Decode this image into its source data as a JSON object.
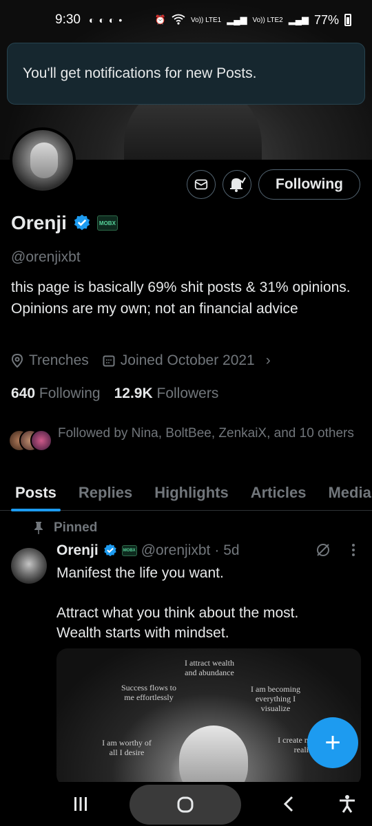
{
  "status_bar": {
    "time": "9:30",
    "battery": "77%",
    "sim1": "Vo)) LTE1",
    "sim2": "Vo)) LTE2"
  },
  "toast": {
    "message": "You'll get notifications for new Posts."
  },
  "profile": {
    "name": "Orenji",
    "org_badge": "MOBX",
    "handle": "@orenjixbt",
    "bio": "this page is basically 69% shit posts & 31% opinions. Opinions are my own; not an financial advice",
    "location": "Trenches",
    "joined": "Joined October 2021",
    "following_count": "640",
    "following_label": "Following",
    "followers_count": "12.9K",
    "followers_label": "Followers",
    "followed_by": "Followed by Nina, BoltBee, ZenkaiX, and 10 others",
    "follow_button": "Following"
  },
  "tabs": [
    "Posts",
    "Replies",
    "Highlights",
    "Articles",
    "Media"
  ],
  "pinned_post": {
    "pinned_label": "Pinned",
    "name": "Orenji",
    "handle": "@orenjixbt",
    "time": "· 5d",
    "text_line1": "Manifest the life you want.",
    "text_line2": "Attract what you think about the most.",
    "text_line3": "Wealth starts with mindset.",
    "image_quotes": {
      "top": "I attract wealth and abundance",
      "left": "Success flows to me effortlessly",
      "right": "I am becoming everything I visualize",
      "bottom_left": "I am worthy of all I desire",
      "bottom_right": "I create my own reality"
    }
  },
  "fab": {
    "label": "+"
  },
  "colors": {
    "accent": "#1d9bf0",
    "background": "#000000",
    "muted": "#71767b",
    "toast_bg": "#16272f"
  }
}
